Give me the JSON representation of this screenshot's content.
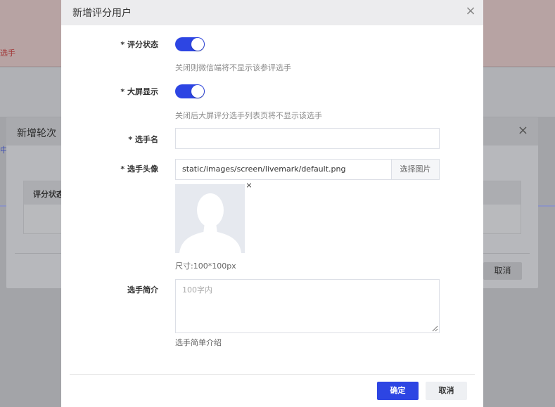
{
  "background": {
    "band_text": "选手",
    "link_text": "中",
    "dialog": {
      "title": "新增轮次",
      "close": "×",
      "table_header": "评分状态",
      "cancel_label": "取消"
    }
  },
  "dialog": {
    "title": "新增评分用户",
    "close": "×",
    "fields": {
      "score_status": {
        "label": "* 评分状态",
        "enabled": true,
        "hint": "关闭则微信端将不显示该参评选手"
      },
      "screen_display": {
        "label": "* 大屏显示",
        "enabled": true,
        "hint": "关闭后大屏评分选手列表页将不显示该选手"
      },
      "name": {
        "label": "* 选手名",
        "value": ""
      },
      "avatar": {
        "label": "* 选手头像",
        "value": "static/images/screen/livemark/default.png",
        "select_button": "选择图片",
        "remove": "×",
        "size_hint": "尺寸:100*100px"
      },
      "intro": {
        "label": "选手简介",
        "placeholder": "100字内",
        "hint": "选手简单介绍"
      }
    },
    "confirm_label": "确定",
    "cancel_label": "取消"
  },
  "colors": {
    "primary": "#2d45e3",
    "overlay": "#a3a4a8",
    "avatar_bg": "#e6e9ef",
    "avatar_figure": "#ffffff"
  }
}
